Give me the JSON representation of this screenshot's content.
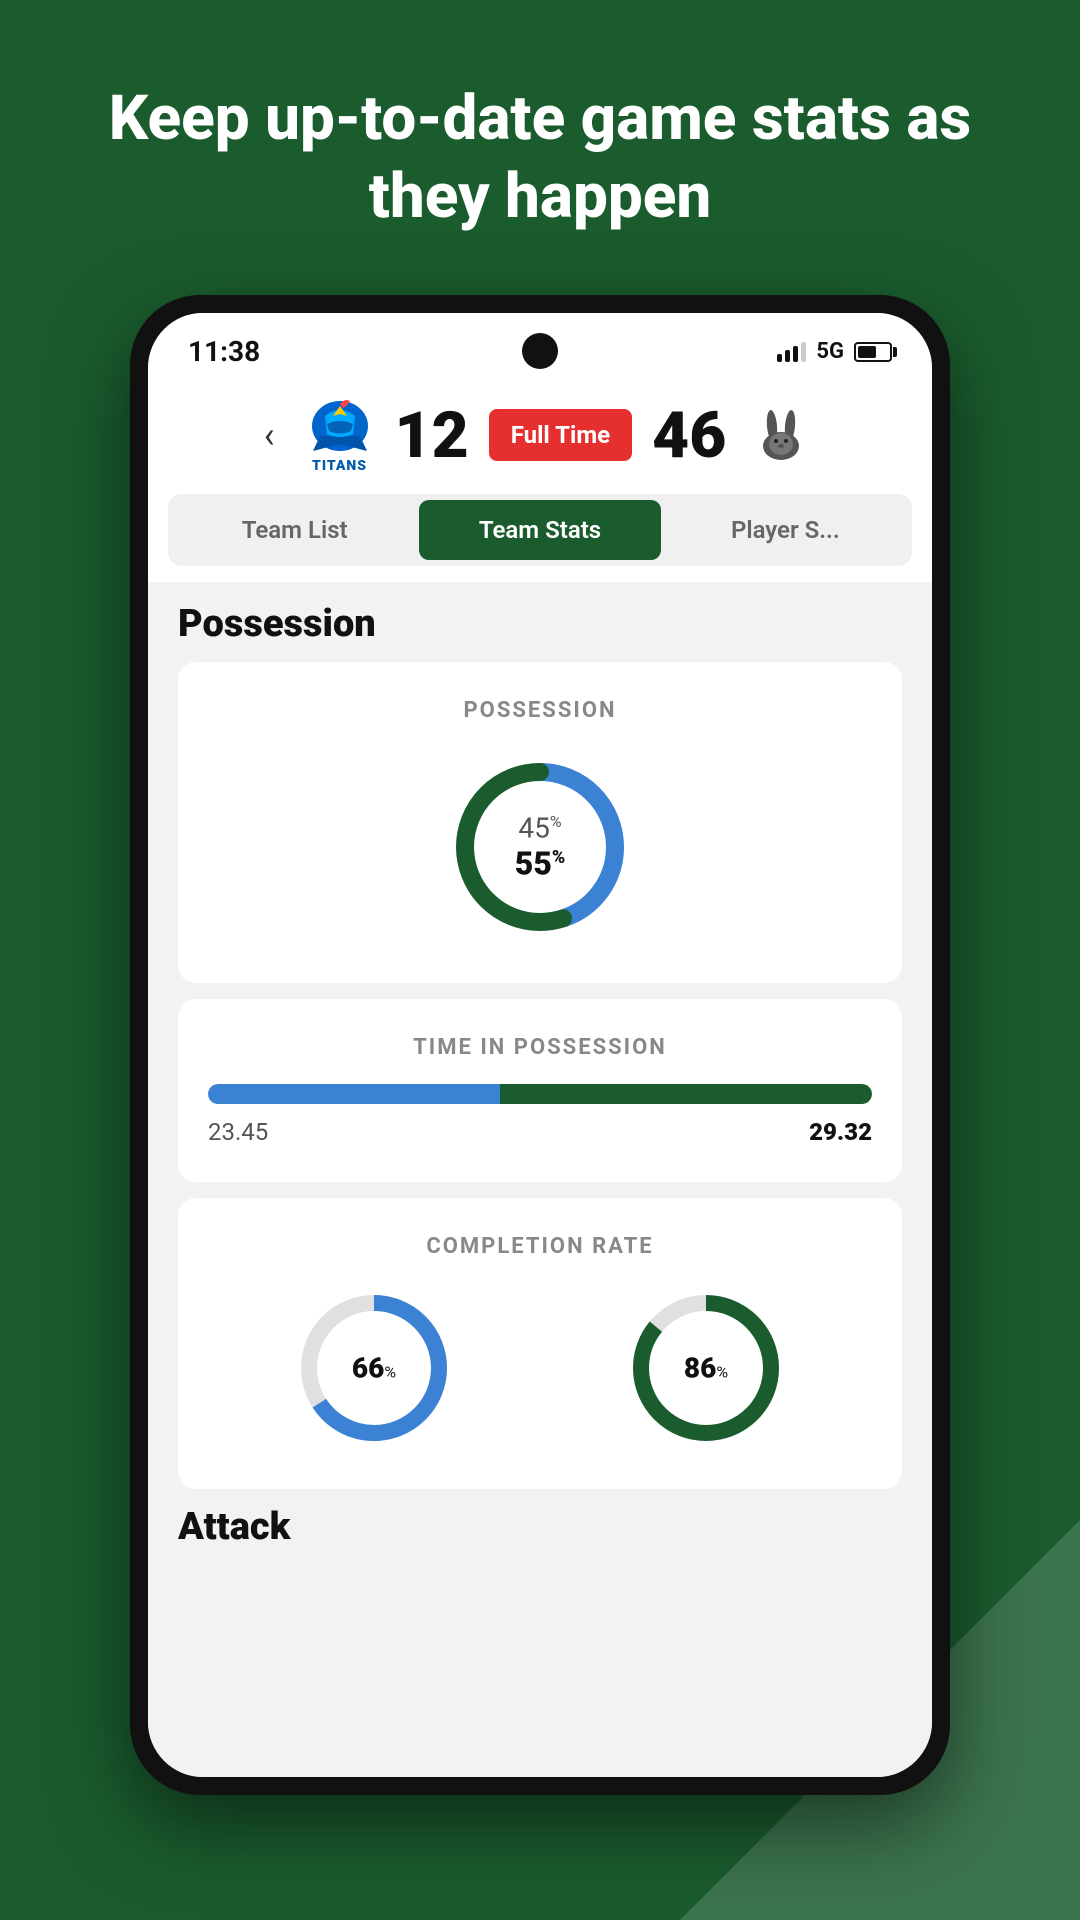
{
  "page": {
    "headline": "Keep up-to-date game stats as they happen"
  },
  "status_bar": {
    "time": "11:38",
    "network": "5G"
  },
  "match": {
    "home_team": "Titans",
    "home_score": "12",
    "status": "Full Time",
    "away_score": "46",
    "away_team": "Rabbitohs"
  },
  "tabs": [
    {
      "label": "Team List",
      "active": false
    },
    {
      "label": "Team Stats",
      "active": true
    },
    {
      "label": "Player S...",
      "active": false
    }
  ],
  "possession_section": {
    "title": "Possession",
    "possession_card": {
      "label": "POSSESSION",
      "team1_pct": "45",
      "team2_pct": "55",
      "team1_color": "#3b82d4",
      "team2_color": "#1a5c2e"
    },
    "time_card": {
      "label": "TIME IN POSSESSION",
      "team1_val": "23.45",
      "team2_val": "29.32",
      "team1_pct": 44,
      "team2_pct": 56
    },
    "completion_card": {
      "label": "COMPLETION RATE",
      "team1_pct": "66",
      "team2_pct": "86",
      "team1_color": "#3b82d4",
      "team2_color": "#1a5c2e"
    }
  },
  "attack_section": {
    "title": "Attack"
  }
}
